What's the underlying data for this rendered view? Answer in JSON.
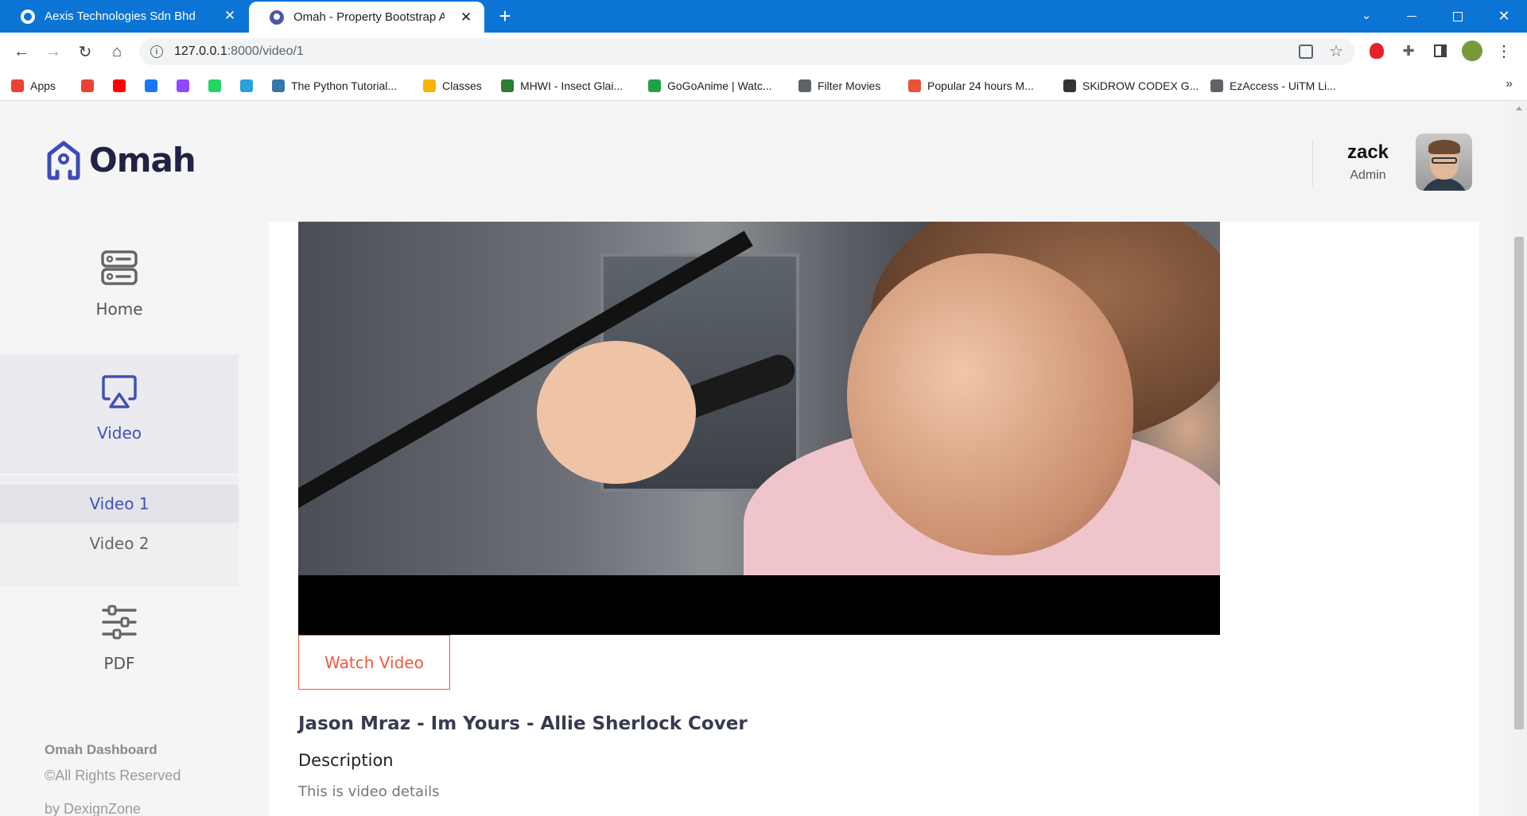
{
  "browser": {
    "tabs": [
      {
        "title": "Aexis Technologies Sdn Bhd",
        "active": false
      },
      {
        "title": "Omah - Property Bootstrap Adm",
        "active": true
      }
    ],
    "new_tab_label": "+",
    "url_host": "127.0.0.1",
    "url_path": ":8000/video/1",
    "bookmarks": [
      {
        "label": "Apps",
        "icon": "apps-grid-icon",
        "color": "#ea4335"
      },
      {
        "label": "",
        "icon": "gmail-icon",
        "color": "#ea4335"
      },
      {
        "label": "",
        "icon": "youtube-icon",
        "color": "#ff0000"
      },
      {
        "label": "",
        "icon": "facebook-icon",
        "color": "#1877f2"
      },
      {
        "label": "",
        "icon": "twitch-icon",
        "color": "#9146ff"
      },
      {
        "label": "",
        "icon": "whatsapp-icon",
        "color": "#25d366"
      },
      {
        "label": "",
        "icon": "telegram-icon",
        "color": "#2aa1da"
      },
      {
        "label": "The Python Tutorial...",
        "icon": "python-icon",
        "color": "#3776ab"
      },
      {
        "label": "Classes",
        "icon": "classroom-icon",
        "color": "#f4b400"
      },
      {
        "label": "MHWI - Insect Glai...",
        "icon": "mhwi-icon",
        "color": "#2e7d32"
      },
      {
        "label": "GoGoAnime | Watc...",
        "icon": "gogoanime-icon",
        "color": "#1fa14a"
      },
      {
        "label": "Filter Movies",
        "icon": "globe-icon",
        "color": "#5f6368"
      },
      {
        "label": "Popular 24 hours M...",
        "icon": "x-icon",
        "color": "#e8533c"
      },
      {
        "label": "SKiDROW CODEX G...",
        "icon": "skull-icon",
        "color": "#333333"
      },
      {
        "label": "EzAccess - UiTM Li...",
        "icon": "globe-icon",
        "color": "#5f6368"
      }
    ]
  },
  "app": {
    "logo_text": "Omah",
    "accent_color": "#3f51b5",
    "sidebar": {
      "items": [
        {
          "label": "Home",
          "icon": "server-icon",
          "active": false
        },
        {
          "label": "Video",
          "icon": "airplay-icon",
          "active": true
        },
        {
          "label": "PDF",
          "icon": "sliders-icon",
          "active": false
        }
      ],
      "video_submenu": [
        {
          "label": "Video 1",
          "active": true
        },
        {
          "label": "Video 2",
          "active": false
        }
      ],
      "footer": {
        "title": "Omah Dashboard",
        "rights": "©All Rights Reserved",
        "by": "by DexignZone"
      }
    },
    "header": {
      "user_name": "zack",
      "user_role": "Admin"
    },
    "main": {
      "watch_button": "Watch Video",
      "video_title": "Jason Mraz - Im Yours - Allie Sherlock Cover",
      "description_label": "Description",
      "description_text": "This is video details"
    }
  }
}
